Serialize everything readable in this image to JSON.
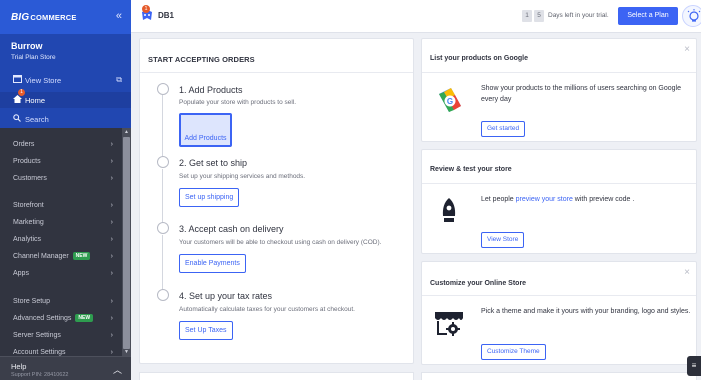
{
  "app": {
    "logo_prefix": "BIG",
    "logo_rest": "COMMERCE",
    "collapse_icon": "double-chevron-left-icon"
  },
  "store": {
    "name": "Burrow",
    "plan": "Trial Plan Store"
  },
  "sidebar": {
    "top_items": [
      {
        "label": "View Store",
        "icon": "store-icon"
      },
      {
        "label": "Home",
        "icon": "home-icon",
        "badge": "1"
      },
      {
        "label": "Search",
        "icon": "search-icon"
      }
    ],
    "menu": [
      {
        "label": "Orders"
      },
      {
        "label": "Products"
      },
      {
        "label": "Customers"
      },
      {
        "label": "Storefront"
      },
      {
        "label": "Marketing"
      },
      {
        "label": "Analytics"
      },
      {
        "label": "Channel Manager",
        "badge": "NEW"
      },
      {
        "label": "Apps"
      },
      {
        "label": "Store Setup"
      },
      {
        "label": "Advanced Settings",
        "badge": "NEW"
      },
      {
        "label": "Server Settings"
      },
      {
        "label": "Account Settings"
      }
    ],
    "help": {
      "label": "Help",
      "pin": "Support PIN: 28410622"
    }
  },
  "topbar": {
    "notification_count": "1",
    "breadcrumb": "DB1",
    "trial_digits": [
      "1",
      "5"
    ],
    "trial_text": "Days left in your trial.",
    "select_plan": "Select a Plan"
  },
  "onboarding": {
    "title": "START ACCEPTING ORDERS",
    "steps": [
      {
        "title": "1. Add Products",
        "desc": "Populate your store with products to sell.",
        "button": "Add Products"
      },
      {
        "title": "2. Get set to ship",
        "desc": "Set up your shipping services and methods.",
        "button": "Set up shipping"
      },
      {
        "title": "3. Accept cash on delivery",
        "desc": "Your customers will be able to checkout using cash on delivery (COD).",
        "button": "Enable Payments"
      },
      {
        "title": "4. Set up your tax rates",
        "desc": "Automatically calculate taxes for your customers at checkout.",
        "button": "Set Up Taxes"
      }
    ]
  },
  "cards": {
    "google": {
      "title": "List your products on Google",
      "body": "Show your products to the millions of users searching on Google every day",
      "button": "Get started"
    },
    "review": {
      "title": "Review & test your store",
      "body_pre": "Let people ",
      "body_link": "preview your store",
      "body_post": " with preview code .",
      "button": "View Store"
    },
    "customize": {
      "title": "Customize your Online Store",
      "body": "Pick a theme and make it yours with your branding, logo and styles.",
      "button": "Customize Theme"
    }
  },
  "colors": {
    "brand_blue": "#3c64f4",
    "sidebar_dark": "#313440",
    "sidebar_blue": "#2147b1",
    "badge_green": "#2e9c4f",
    "notification_orange": "#e55b2b"
  }
}
